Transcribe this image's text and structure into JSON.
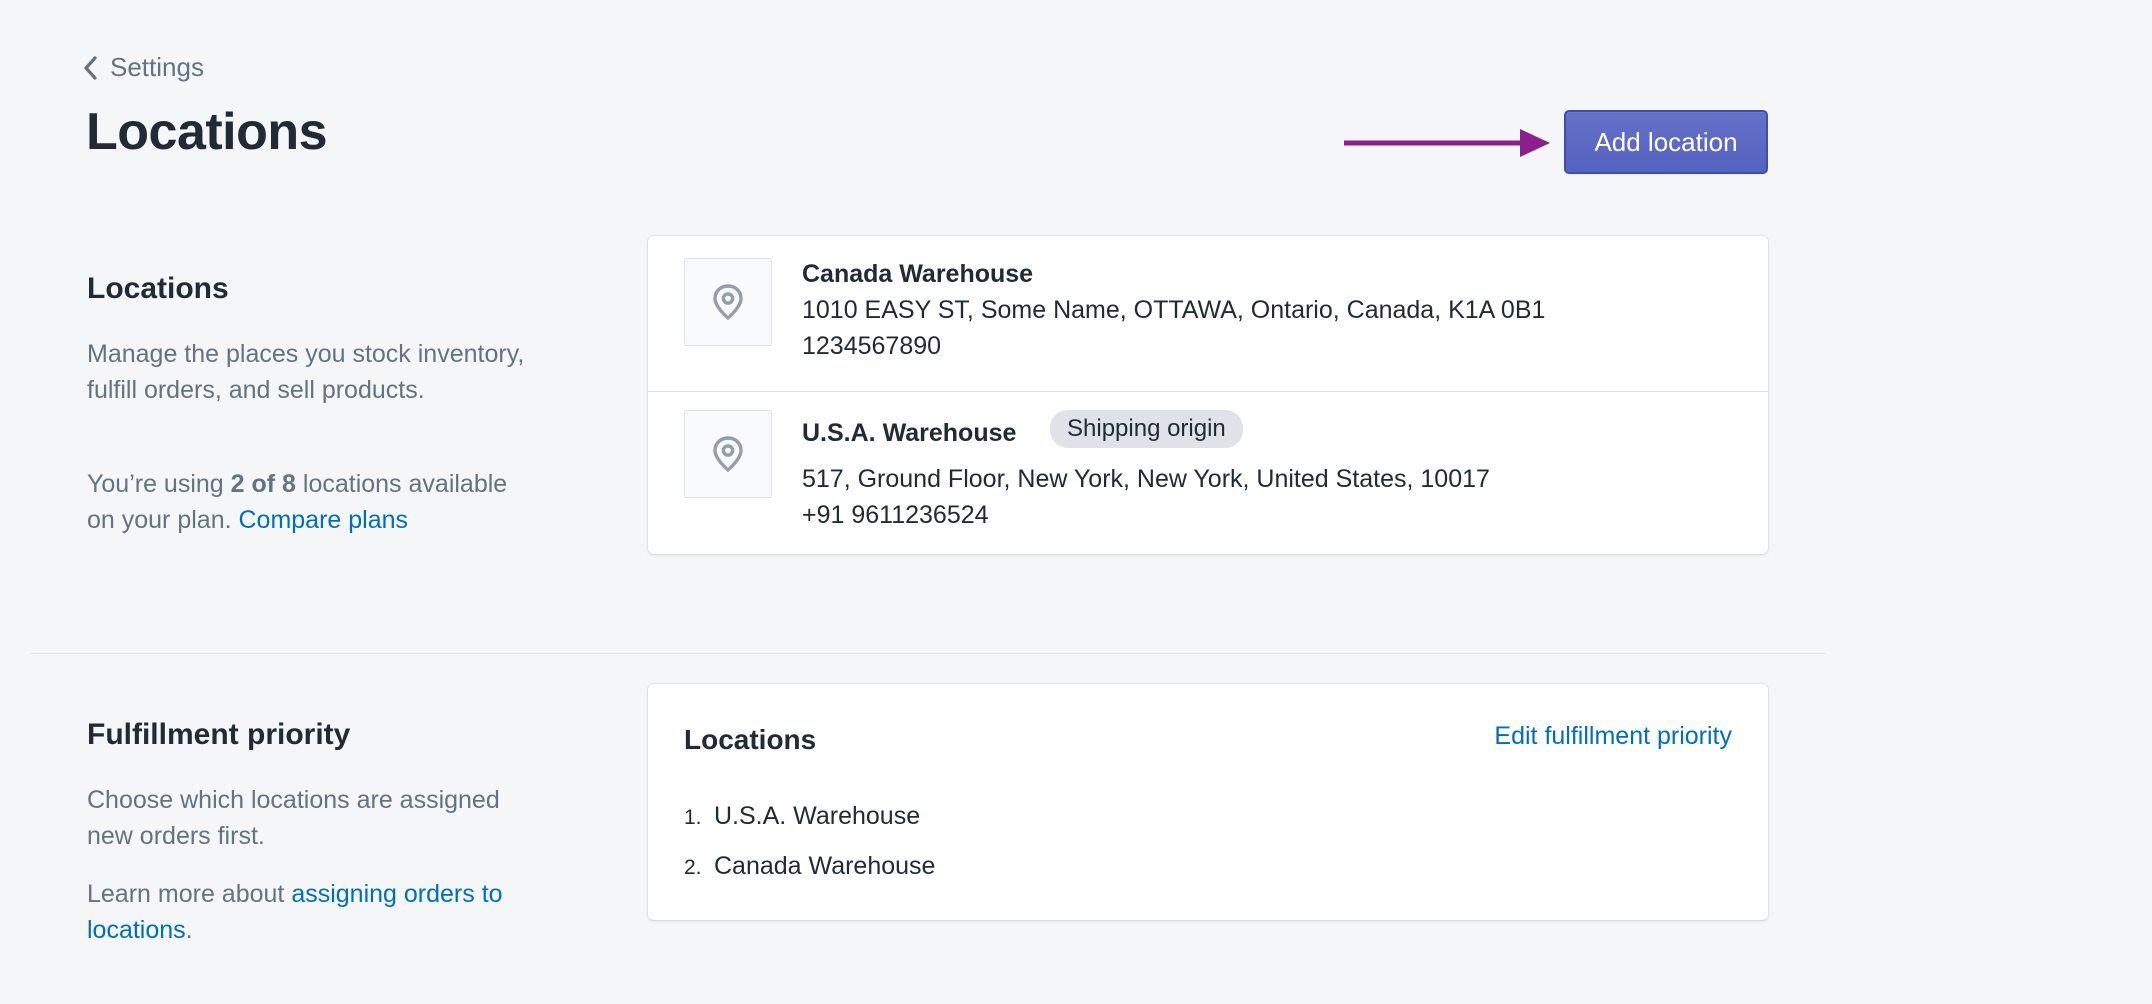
{
  "breadcrumb": {
    "label": "Settings"
  },
  "page": {
    "title": "Locations",
    "add_button_label": "Add location"
  },
  "locations_section": {
    "heading": "Locations",
    "description": "Manage the places you stock inventory, fulfill orders, and sell products.",
    "usage_prefix": "You’re using",
    "usage_count": "2 of 8",
    "usage_suffix": "locations available on your plan.",
    "compare_link": "Compare plans"
  },
  "locations": [
    {
      "name": "Canada Warehouse",
      "address": "1010 EASY ST, Some Name, OTTAWA, Ontario, Canada, K1A 0B1",
      "phone": "1234567890",
      "badge": ""
    },
    {
      "name": "U.S.A. Warehouse",
      "address": "517, Ground Floor, New York, New York, United States, 10017",
      "phone": "+91 9611236524",
      "badge": "Shipping origin"
    }
  ],
  "fulfillment_section": {
    "heading": "Fulfillment priority",
    "description": "Choose which locations are assigned new orders first.",
    "learn_prefix": "Learn more about",
    "learn_link": "assigning orders to locations",
    "learn_suffix": "."
  },
  "fulfillment_card": {
    "title": "Locations",
    "edit_link": "Edit fulfillment priority",
    "items": [
      {
        "num": "1.",
        "name": "U.S.A. Warehouse"
      },
      {
        "num": "2.",
        "name": "Canada Warehouse"
      }
    ]
  },
  "colors": {
    "primary": "#5c6ac4",
    "link": "#006fbb",
    "annotation_arrow": "#8b1f8b",
    "background": "#f4f6f8"
  },
  "icons": [
    "chevron-left-icon",
    "location-pin-icon",
    "annotation-arrow-icon"
  ]
}
